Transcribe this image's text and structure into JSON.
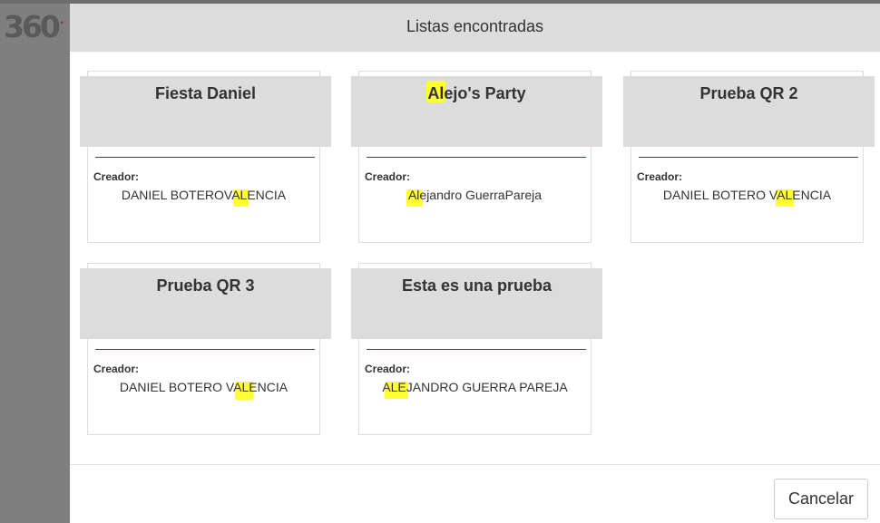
{
  "app": {
    "logo_text": "360"
  },
  "dialog": {
    "title": "Listas encontradas",
    "creator_label": "Creador:",
    "cancel_label": "Cancelar"
  },
  "lists": [
    {
      "title": "Fiesta Daniel",
      "creator": "DANIEL BOTEROVALENCIA",
      "match": "AL"
    },
    {
      "title": "Alejo's Party",
      "creator": "Alejandro GuerraPareja",
      "match": "Al"
    },
    {
      "title": "Prueba QR 2",
      "creator": "DANIEL BOTERO VALENCIA",
      "match": "AL"
    },
    {
      "title": "Prueba QR 3",
      "creator": "DANIEL BOTERO VALENCIA",
      "match": "AL"
    },
    {
      "title": "Esta es una prueba",
      "creator": "ALEJANDRO GUERRA PAREJA",
      "match": "ALE"
    }
  ],
  "colors": {
    "highlight": "#ffff33",
    "separator": "#8a1c5a",
    "header_bg": "#dcdcdc"
  }
}
